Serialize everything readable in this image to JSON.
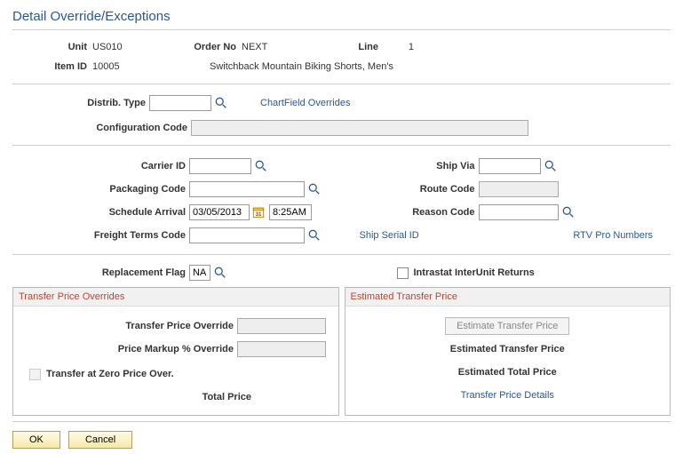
{
  "title": "Detail Override/Exceptions",
  "header": {
    "unit_lbl": "Unit",
    "unit": "US010",
    "orderno_lbl": "Order No",
    "orderno": "NEXT",
    "line_lbl": "Line",
    "line": "1",
    "itemid_lbl": "Item ID",
    "itemid": "10005",
    "item_desc": "Switchback Mountain Biking Shorts, Men's"
  },
  "distrib": {
    "label": "Distrib. Type",
    "value": "",
    "chartfield_link": "ChartField Overrides"
  },
  "config": {
    "label": "Configuration Code",
    "value": ""
  },
  "mid": {
    "carrier_lbl": "Carrier ID",
    "carrier": "",
    "shipvia_lbl": "Ship Via",
    "shipvia": "",
    "pack_lbl": "Packaging Code",
    "pack": "",
    "route_lbl": "Route Code",
    "route": "",
    "sched_lbl": "Schedule Arrival",
    "sched_date": "03/05/2013",
    "sched_time": "8:25AM",
    "reason_lbl": "Reason Code",
    "reason": "",
    "freight_lbl": "Freight Terms Code",
    "freight": "",
    "shipserial_lbl": "Ship Serial ID",
    "rtv_lbl": "RTV Pro Numbers"
  },
  "lower": {
    "repl_lbl": "Replacement Flag",
    "repl": "NA",
    "intrastat_lbl": "Intrastat InterUnit Returns"
  },
  "panel_left": {
    "title": "Transfer Price Overrides",
    "price_override_lbl": "Transfer Price Override",
    "price_override": "",
    "markup_lbl": "Price Markup % Override",
    "markup": "",
    "zero_lbl": "Transfer at Zero Price Over.",
    "total_lbl": "Total Price"
  },
  "panel_right": {
    "title": "Estimated Transfer Price",
    "btn": "Estimate Transfer Price",
    "etp_lbl": "Estimated Transfer Price",
    "etot_lbl": "Estimated Total Price",
    "details_link": "Transfer Price Details"
  },
  "footer": {
    "ok": "OK",
    "cancel": "Cancel"
  }
}
